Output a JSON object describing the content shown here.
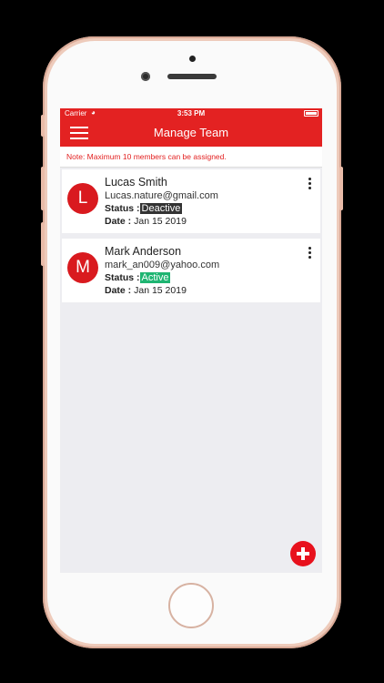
{
  "statusbar": {
    "carrier": "Carrier",
    "time": "3:53 PM"
  },
  "header": {
    "title": "Manage Team",
    "menu_icon": "hamburger-menu-icon"
  },
  "note": "Note: Maximum 10 members can be assigned.",
  "members": [
    {
      "initial": "L",
      "name": "Lucas Smith",
      "email": "Lucas.nature@gmail.com",
      "status_label": "Status :",
      "status": "Deactive",
      "date_label": "Date :",
      "date": "Jan 15 2019"
    },
    {
      "initial": "M",
      "name": "Mark Anderson",
      "email": "mark_an009@yahoo.com",
      "status_label": "Status :",
      "status": "Active",
      "date_label": "Date :",
      "date": "Jan 15 2019"
    }
  ],
  "colors": {
    "accent": "#e32222",
    "avatar": "#d91a1f",
    "active": "#1fb572",
    "deactive": "#333333"
  },
  "fab_icon": "plus-icon"
}
